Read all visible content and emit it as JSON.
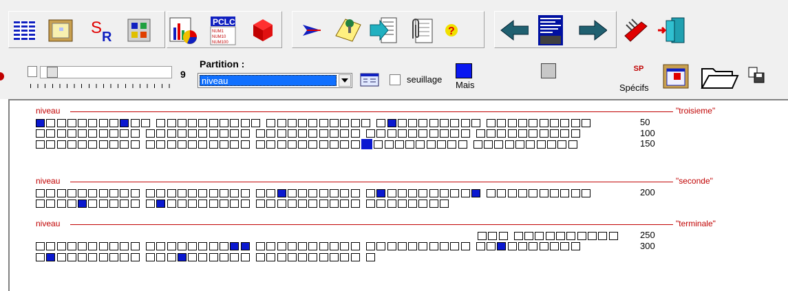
{
  "toolbar": {
    "group1": [
      "grid-icon",
      "calendar-icon",
      "sr-icon",
      "layout-icon"
    ],
    "group2": [
      "chart-icon",
      "pclc-icon",
      "cube-icon"
    ],
    "group3": [
      "arrow-icon",
      "note-icon",
      "export-icon",
      "clip-icon",
      "help-icon"
    ],
    "group4": [
      "back-icon",
      "list-icon",
      "forward-icon"
    ],
    "group5": [
      "tools-icon",
      "exit-icon"
    ],
    "sr_label_s": "S",
    "sr_label_r": "R",
    "pclc_label": "PCLC",
    "pclc_lines": [
      "NUM1",
      "NUM10",
      "NUM100"
    ],
    "help_label": "?"
  },
  "controls": {
    "slider_value": "9",
    "slider_level": 0.05,
    "partition_label": "Partition :",
    "partition_value": "niveau",
    "seuillage_label": "seuillage",
    "mais_label": "Mais",
    "specifs_label": "Spécifs",
    "sp_label": "SP"
  },
  "colors": {
    "accent": "#0a18d0",
    "group_line": "#c00000"
  },
  "groups": [
    {
      "label": "niveau",
      "tag": "\"troisieme\"",
      "rows": [
        {
          "pattern": "X0000000X00 0000000000 0000000000 0X00000000 0000000000",
          "count": "50"
        },
        {
          "pattern": "0000000000 0000000000 0000000000 0000000000 0000000000",
          "count": "100"
        },
        {
          "pattern": "0000000000 0000000000 0000000000B000000000 0000000000",
          "count": "150"
        }
      ]
    },
    {
      "label": "niveau",
      "tag": "\"seconde\"",
      "rows": [
        {
          "pattern": "0000000000 0000000000 00X0000000 0X00000000X 0000000000",
          "count": "200"
        },
        {
          "pattern": "0000X00000 0X00000000 0000000000 00000000",
          "count": ""
        }
      ]
    },
    {
      "label": "niveau",
      "tag": "\"terminale\"",
      "rows": [
        {
          "pattern": "000 0000000000",
          "count": "250",
          "offset": 680
        },
        {
          "pattern": "0000000000 00000000XX 0000000000 0000000000 00X0000000",
          "count": "300"
        },
        {
          "pattern": "0X00000000 000X000000 0000000000 0",
          "count": ""
        }
      ]
    }
  ]
}
